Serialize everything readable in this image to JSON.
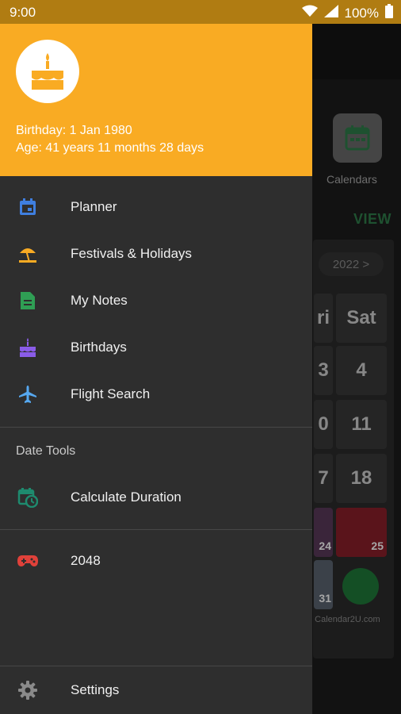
{
  "status_bar": {
    "time": "9:00",
    "battery": "100%"
  },
  "drawer": {
    "birthday": "Birthday: 1 Jan 1980",
    "age": "Age: 41 years 11 months 28 days",
    "header_color": "#f9ab23",
    "items": [
      {
        "label": "Planner",
        "icon": "calendar-icon",
        "color": "#3f7fe0"
      },
      {
        "label": "Festivals & Holidays",
        "icon": "beach-umbrella-icon",
        "color": "#f9ab23"
      },
      {
        "label": "My Notes",
        "icon": "note-icon",
        "color": "#2f9e54"
      },
      {
        "label": "Birthdays",
        "icon": "cake-icon",
        "color": "#8a5ce8"
      },
      {
        "label": "Flight Search",
        "icon": "airplane-icon",
        "color": "#56a8f0"
      }
    ],
    "section_title": "Date Tools",
    "tools": [
      {
        "label": "Calculate Duration",
        "icon": "calendar-clock-icon",
        "color": "#1e8a6e"
      }
    ],
    "games": [
      {
        "label": "2048",
        "icon": "gamepad-icon",
        "color": "#e0413a"
      }
    ],
    "settings_label": "Settings"
  },
  "background": {
    "calendars_label": "Calendars",
    "view_label": "VIEW",
    "year_chip": "2022 >",
    "day_labels": [
      "ri",
      "Sat"
    ],
    "days": [
      "3",
      "4",
      "0",
      "11",
      "7",
      "18"
    ],
    "photo_days": [
      "24",
      "25",
      "31"
    ],
    "credit": "© Calendar2U.com"
  }
}
